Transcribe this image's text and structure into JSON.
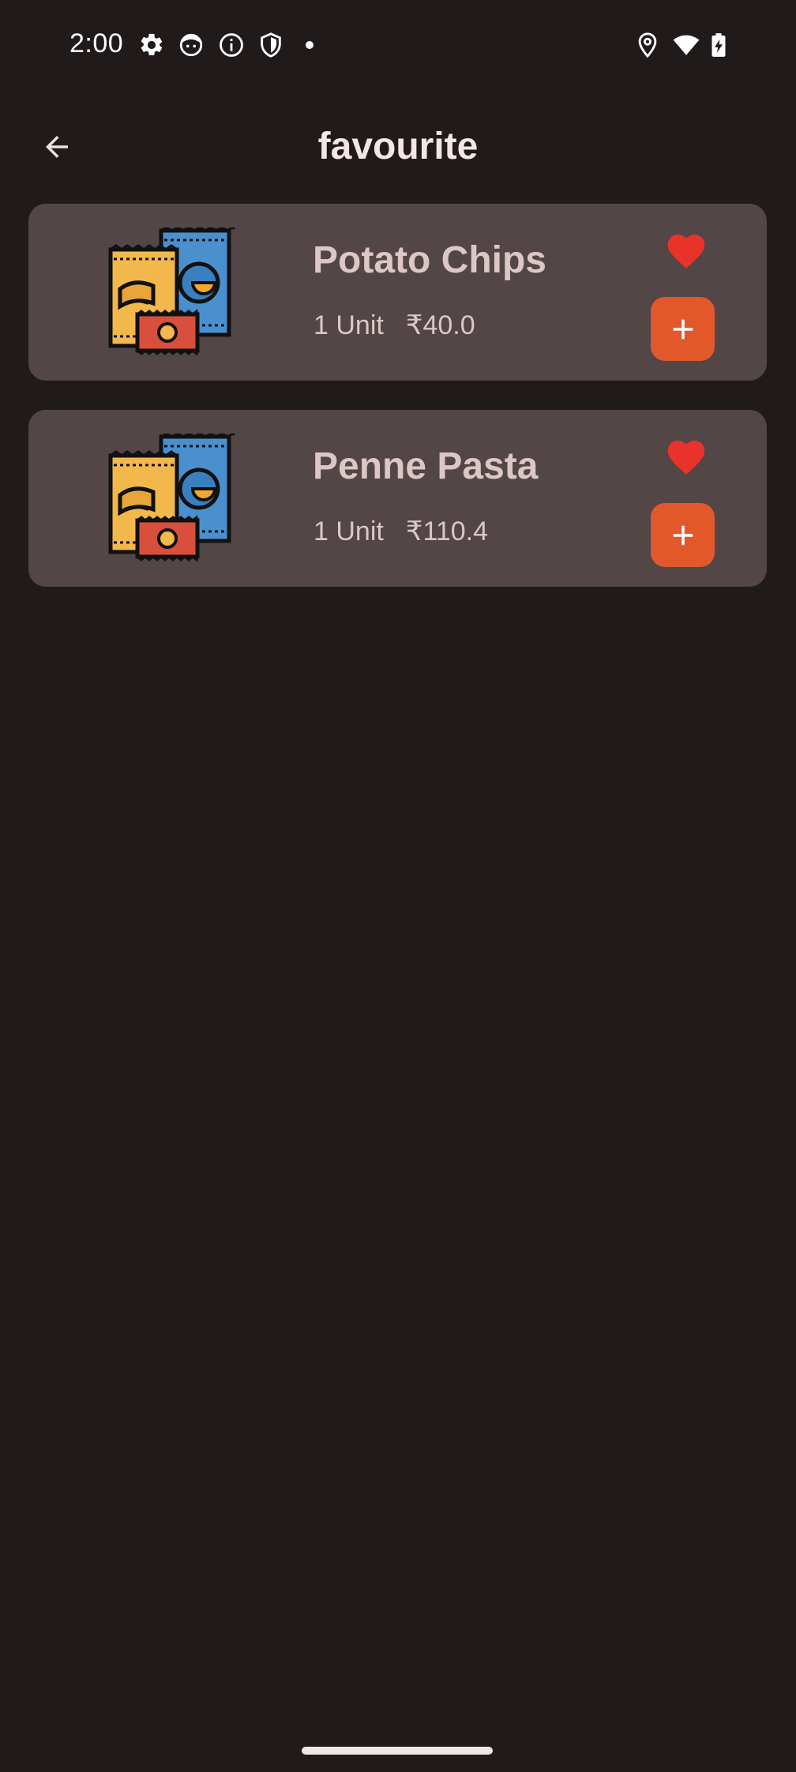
{
  "status_bar": {
    "time": "2:00",
    "left_icons": [
      "settings-icon",
      "face-icon",
      "info-icon",
      "shield-icon",
      "notification-dot"
    ],
    "right_icons": [
      "location-icon",
      "wifi-icon",
      "battery-charging-icon"
    ]
  },
  "app_bar": {
    "title": "favourite",
    "back_icon": "arrow-back-icon"
  },
  "favourites": [
    {
      "name": "Potato Chips",
      "unit": "1 Unit",
      "price": "₹40.0",
      "thumbnail": "snacks-icon",
      "favourite": true
    },
    {
      "name": "Penne Pasta",
      "unit": "1 Unit",
      "price": "₹110.4",
      "thumbnail": "snacks-icon",
      "favourite": true
    }
  ],
  "colors": {
    "background": "#201a1b",
    "card": "#524646",
    "accent": "#e3582b",
    "heart": "#e8322a",
    "text": "#dcc6c6",
    "title": "#f3e6e6"
  }
}
